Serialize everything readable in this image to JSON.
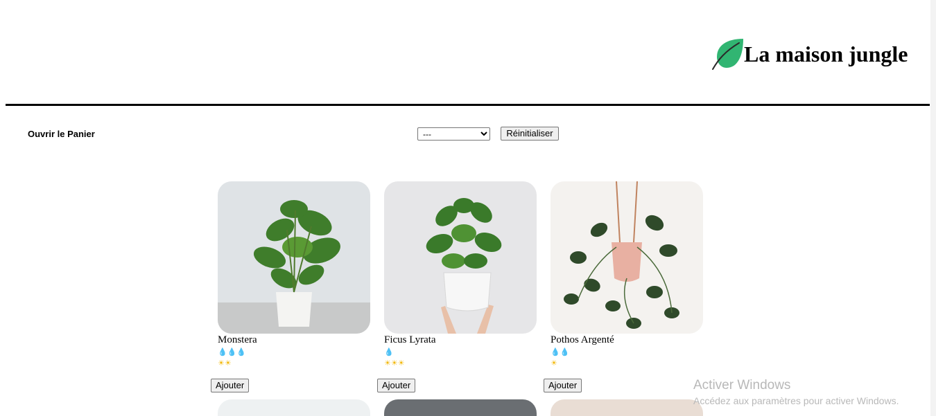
{
  "banner": {
    "title": "La maison jungle",
    "logo_icon": "leaf-icon",
    "logo_color": "#31b572"
  },
  "cart": {
    "toggle_label": "Ouvrir le Panier"
  },
  "filter": {
    "selected_option": "---",
    "reset_label": "Réinitialiser"
  },
  "plants": [
    {
      "name": "Monstera",
      "water": "💧💧💧",
      "light": "☀☀",
      "add_label": "Ajouter",
      "image_icon": "monstera-image"
    },
    {
      "name": "Ficus Lyrata",
      "water": "💧",
      "light": "☀☀☀",
      "add_label": "Ajouter",
      "image_icon": "ficus-image"
    },
    {
      "name": "Pothos Argenté",
      "water": "💧💧",
      "light": "☀",
      "add_label": "Ajouter",
      "image_icon": "pothos-image"
    }
  ],
  "watermark": {
    "title": "Activer Windows",
    "subtitle": "Accédez aux paramètres pour activer Windows."
  }
}
